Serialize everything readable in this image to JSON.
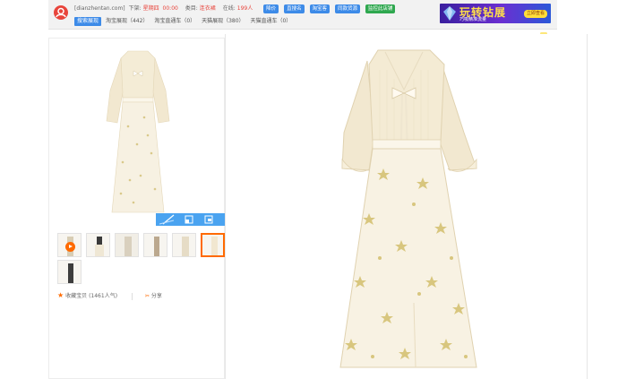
{
  "toolbar": {
    "site": "[dianzhentan.com]",
    "shelf_label": "下架:",
    "shelf_day": "星期四",
    "shelf_time": "00:00",
    "category_label": "类目:",
    "category_value": "连衣裙",
    "online_label": "在线:",
    "online_value": "199人",
    "buttons": [
      "降价",
      "直搜名",
      "淘宝客",
      "同款货源",
      "监控此店铺"
    ],
    "tabs": [
      {
        "label": "搜索展现",
        "active": true
      },
      {
        "label": "淘宝展现（442）"
      },
      {
        "label": "淘宝直通车（0）"
      },
      {
        "label": "天猫展现（380）"
      },
      {
        "label": "天猫直通车（0）"
      }
    ]
  },
  "ad": {
    "title": "玩转钻展",
    "subtitle": "巧吸精准流量",
    "cta": "立即查看"
  },
  "gallery": {
    "thumbnail_count": 7,
    "active_index": 5,
    "favorites": "收藏宝贝 (1461人气)",
    "share": "分享"
  },
  "colors": {
    "brand_red": "#e8443b",
    "button_blue": "#3d8be8",
    "button_green": "#2fa84f",
    "accent_orange": "#ff6a00",
    "dress_cream": "#f3ecd9"
  },
  "icons": {
    "logo": "dianzhentan-logo-icon",
    "video": "play-video-icon",
    "favorite": "star-icon",
    "share": "share-icon",
    "overlay": [
      "resize-icon",
      "window-icon",
      "close-icon"
    ]
  }
}
